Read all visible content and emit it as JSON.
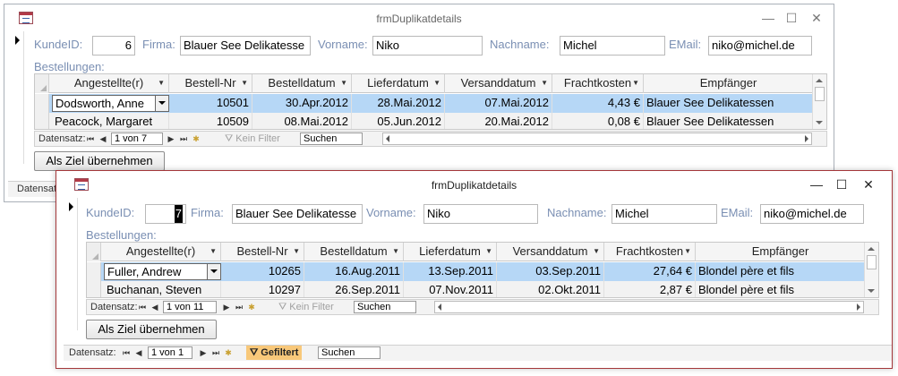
{
  "back_window": {
    "title": "frmDuplikatdetails",
    "controls": {
      "minimize": "—",
      "maximize": "☐",
      "close": "✕"
    },
    "fields": {
      "kunde_id_label": "KundeID:",
      "kunde_id_value": "6",
      "firma_label": "Firma:",
      "firma_value": "Blauer See Delikatesse",
      "vorname_label": "Vorname:",
      "vorname_value": "Niko",
      "nachname_label": "Nachname:",
      "nachname_value": "Michel",
      "email_label": "EMail:",
      "email_value": "niko@michel.de"
    },
    "subform_label": "Bestellungen:",
    "columns": [
      "Angestellte(r)",
      "Bestell-Nr",
      "Bestelldatum",
      "Lieferdatum",
      "Versanddatum",
      "Frachtkosten",
      "Empfänger"
    ],
    "rows": [
      {
        "angestellte": "Dodsworth, Anne",
        "nr": "10501",
        "bestelldatum": "30.Apr.2012",
        "lieferdatum": "28.Mai.2012",
        "versanddatum": "07.Mai.2012",
        "fracht": "4,43 €",
        "empfaenger": "Blauer See Delikatessen"
      },
      {
        "angestellte": "Peacock, Margaret",
        "nr": "10509",
        "bestelldatum": "08.Mai.2012",
        "lieferdatum": "05.Jun.2012",
        "versanddatum": "20.Mai.2012",
        "fracht": "0,08 €",
        "empfaenger": "Blauer See Delikatessen"
      }
    ],
    "nav": {
      "label": "Datensatz:",
      "position": "1 von 7",
      "filter": "Kein Filter",
      "search": "Suchen",
      "first": "⏮",
      "prev": "◀",
      "next": "▶",
      "last": "⏭",
      "new": "✱"
    },
    "button": "Als Ziel übernehmen",
    "status_label": "Datensatz:"
  },
  "front_window": {
    "title": "frmDuplikatdetails",
    "controls": {
      "minimize": "—",
      "maximize": "☐",
      "close": "✕"
    },
    "fields": {
      "kunde_id_label": "KundeID:",
      "kunde_id_value": "7",
      "firma_label": "Firma:",
      "firma_value": "Blauer See Delikatesse",
      "vorname_label": "Vorname:",
      "vorname_value": "Niko",
      "nachname_label": "Nachname:",
      "nachname_value": "Michel",
      "email_label": "EMail:",
      "email_value": "niko@michel.de"
    },
    "subform_label": "Bestellungen:",
    "columns": [
      "Angestellte(r)",
      "Bestell-Nr",
      "Bestelldatum",
      "Lieferdatum",
      "Versanddatum",
      "Frachtkosten",
      "Empfänger"
    ],
    "rows": [
      {
        "angestellte": "Fuller, Andrew",
        "nr": "10265",
        "bestelldatum": "16.Aug.2011",
        "lieferdatum": "13.Sep.2011",
        "versanddatum": "03.Sep.2011",
        "fracht": "27,64 €",
        "empfaenger": "Blondel père et fils"
      },
      {
        "angestellte": "Buchanan, Steven",
        "nr": "10297",
        "bestelldatum": "26.Sep.2011",
        "lieferdatum": "07.Nov.2011",
        "versanddatum": "02.Okt.2011",
        "fracht": "2,87 €",
        "empfaenger": "Blondel père et fils"
      }
    ],
    "nav": {
      "label": "Datensatz:",
      "position": "1 von 11",
      "filter": "Kein Filter",
      "search": "Suchen",
      "first": "⏮",
      "prev": "◀",
      "next": "▶",
      "last": "⏭",
      "new": "✱"
    },
    "button": "Als Ziel übernehmen",
    "main_nav": {
      "label": "Datensatz:",
      "position": "1 von 1",
      "filter": "Gefiltert",
      "search": "Suchen",
      "first": "⏮",
      "prev": "◀",
      "next": "▶",
      "last": "⏭",
      "new": "✱"
    }
  },
  "colors": {
    "selected_row": "#b6d7f6",
    "label_blue": "#7a8fb3",
    "front_border": "#a4373a",
    "filter_active": "#f8c87a"
  }
}
